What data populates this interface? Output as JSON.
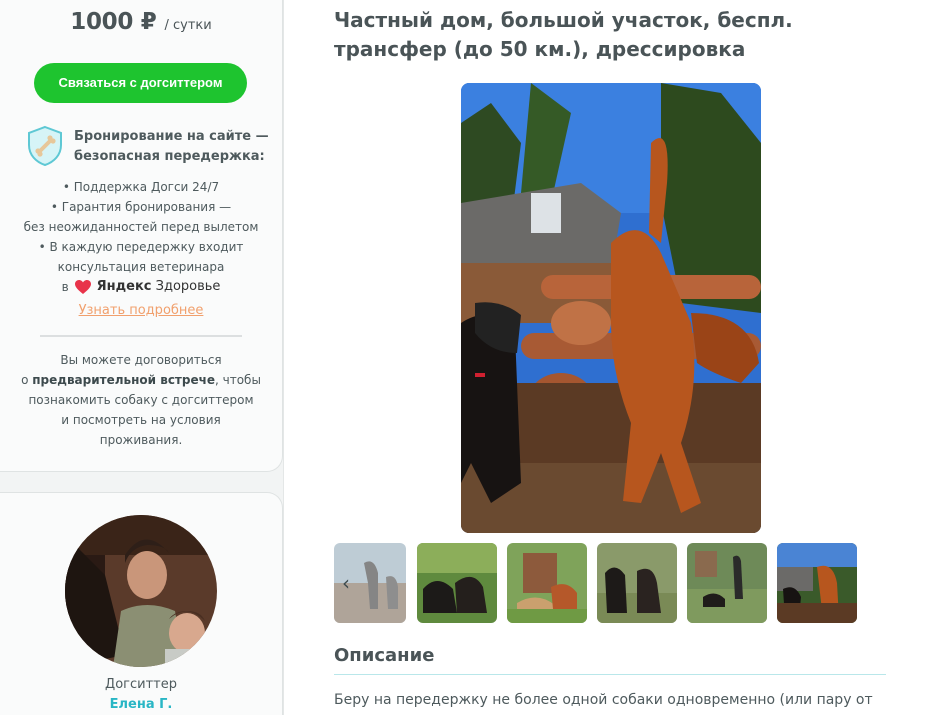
{
  "booking": {
    "price": "1000 ₽",
    "per_day": "/ сутки",
    "contact_button": "Связаться с догситтером",
    "safe_title": "Бронирование на сайте — безопасная передержка:",
    "features": [
      "• Поддержка Догси 24/7",
      "• Гарантия бронирования —",
      "без неожиданностей перед вылетом",
      "• В каждую передержку входит",
      "консультация ветеринара"
    ],
    "ya_prefix": "в",
    "ya_brand_bold": "Яндекс",
    "ya_brand_rest": "Здоровье",
    "more_link": "Узнать подробнее",
    "meeting_before": "Вы можете договориться",
    "meeting_prefix": "о",
    "meeting_bold": "предварительной встрече",
    "meeting_after": ", чтобы",
    "meeting_rest": [
      "познакомить собаку с догситтером",
      "и посмотреть на условия",
      "проживания."
    ]
  },
  "sitter": {
    "role": "Догситтер",
    "name": "Елена Г."
  },
  "listing": {
    "title": "Частный дом, большой участок, беспл. трансфер (до 50 км.), дрессировка",
    "prev_arrow": "‹",
    "section_title": "Описание",
    "description": "Беру на передержку не более одной собаки одновременно (или пару от"
  },
  "colors": {
    "accent_green": "#1ec42f",
    "link_orange": "#f1a06d",
    "name_teal": "#29b6c5",
    "heart_red": "#e8334a"
  },
  "icons": {
    "shield": "shield-bone-icon",
    "heart": "heart-icon",
    "prev": "chevron-left-icon"
  }
}
